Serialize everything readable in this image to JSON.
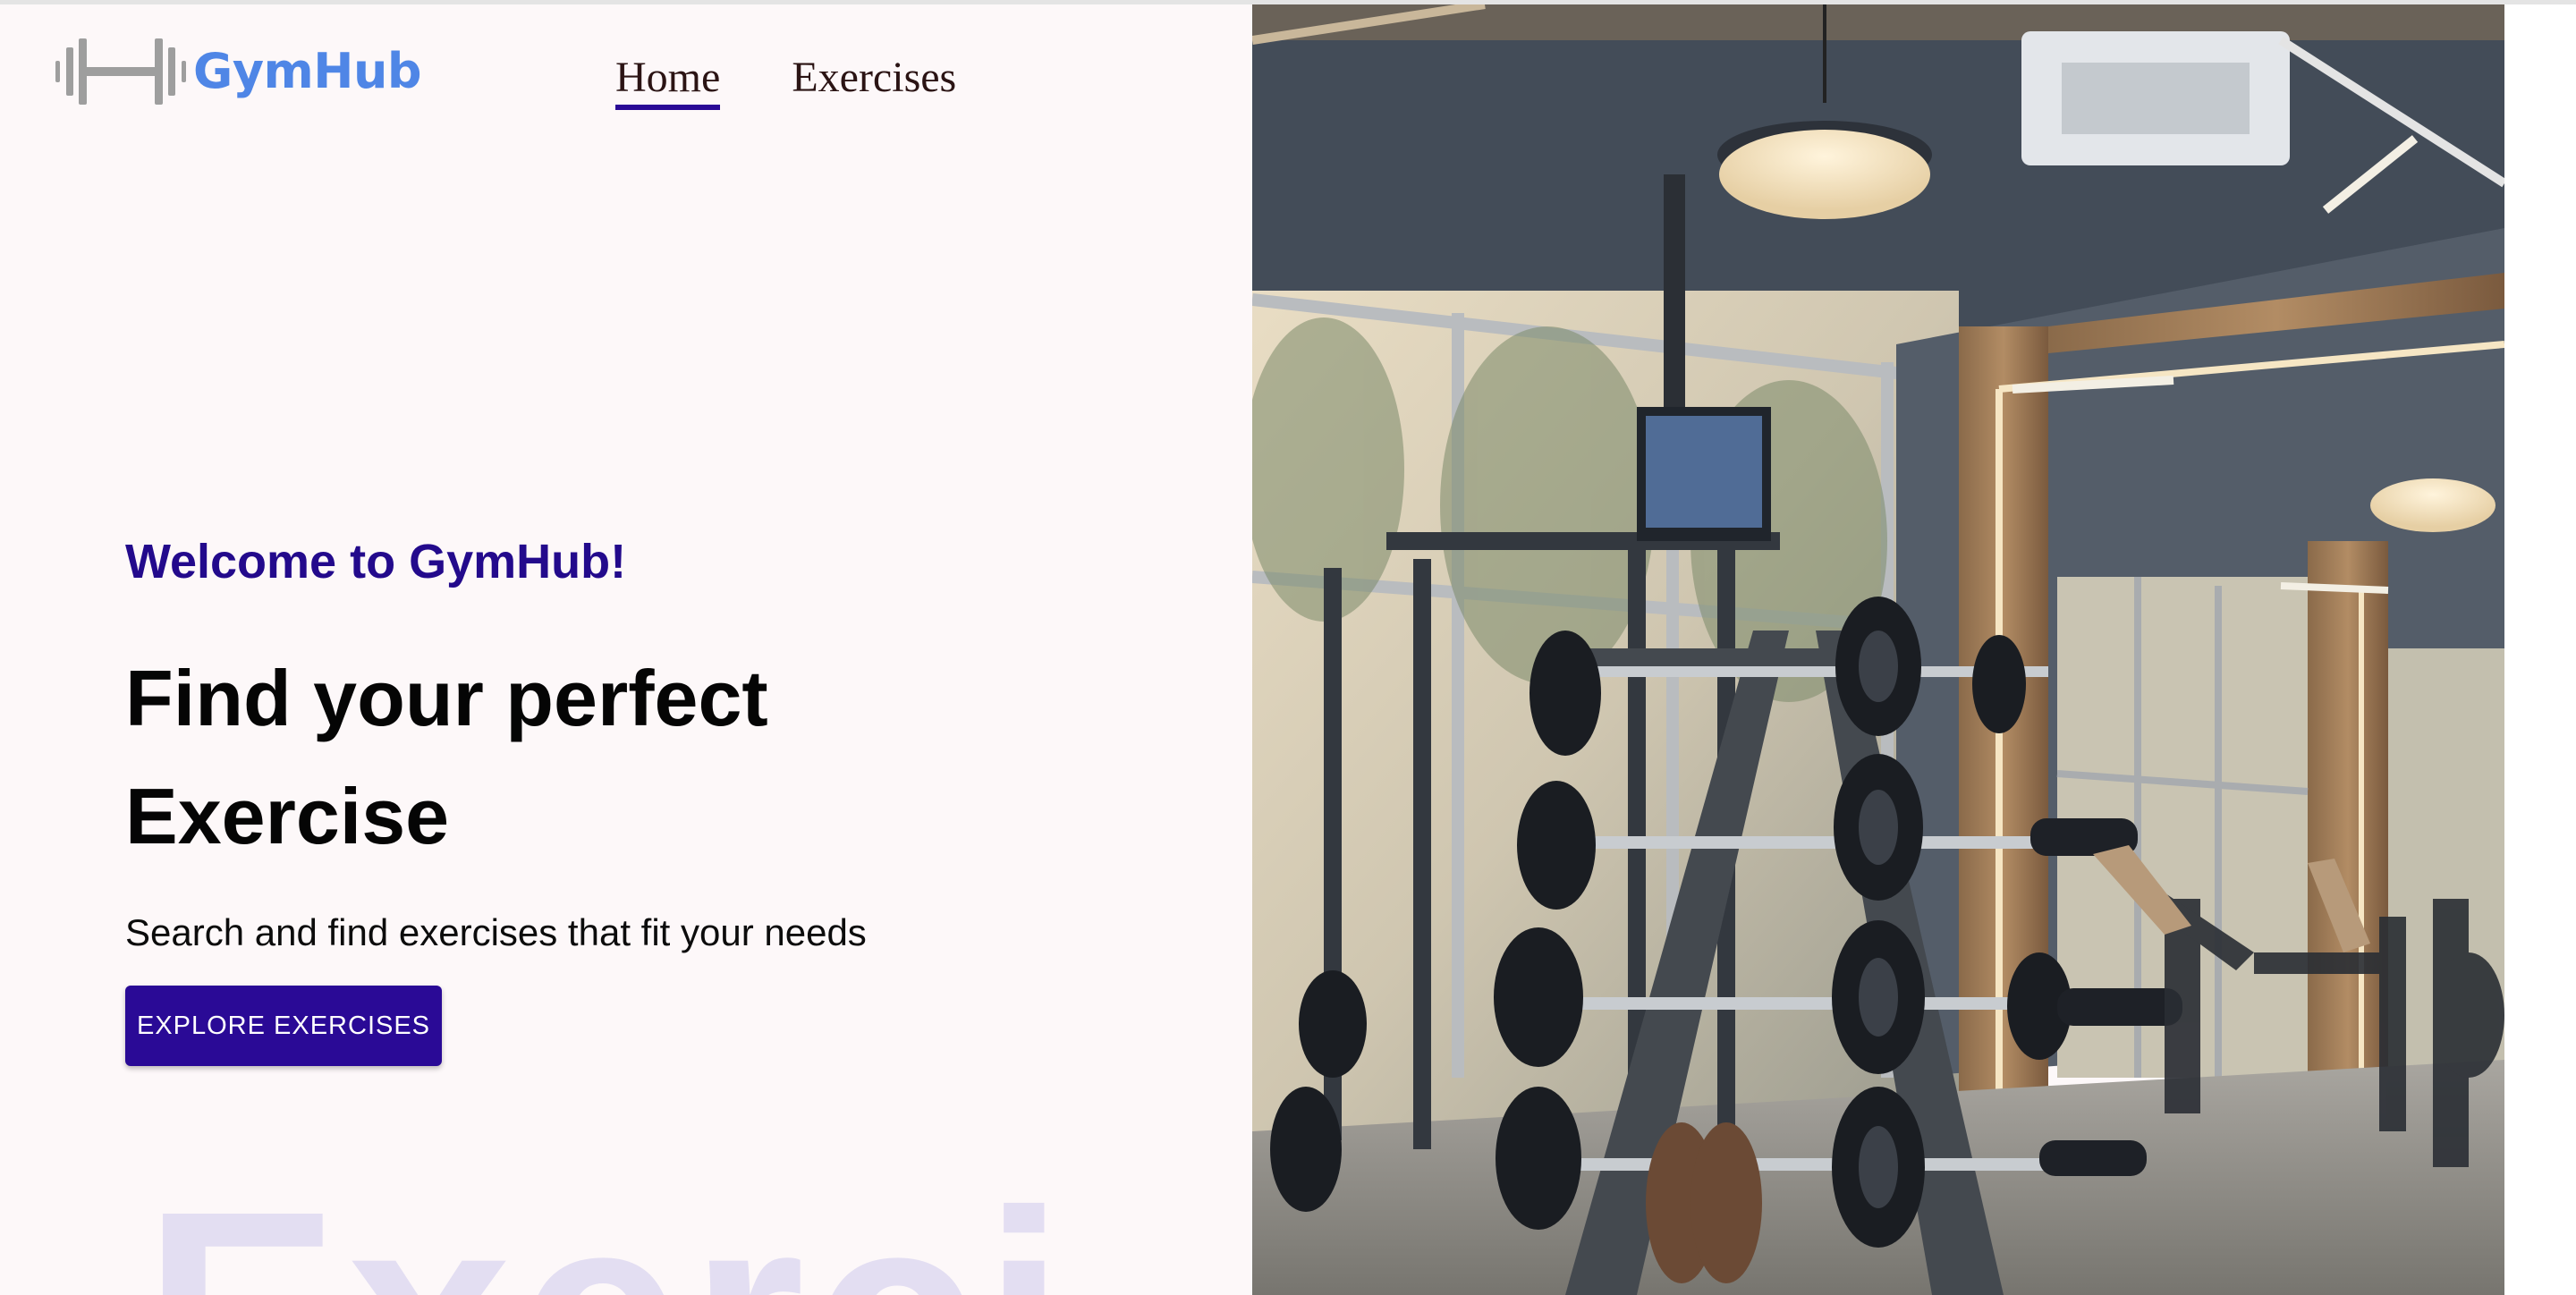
{
  "brand": {
    "name": "GymHub",
    "logo_icon": "barbell-icon",
    "text_color": "#4f86e6",
    "icon_color": "#9e9e9e"
  },
  "nav": {
    "items": [
      {
        "label": "Home",
        "active": true
      },
      {
        "label": "Exercises",
        "active": false
      }
    ],
    "active_underline_color": "#2a0a96"
  },
  "hero": {
    "welcome": "Welcome to GymHub!",
    "headline_line1": "Find your perfect",
    "headline_line2": "Exercise",
    "subtext": "Search and find exercises that fit your needs",
    "cta_label": "EXPLORE EXERCISES",
    "background_word": "Exerci",
    "accent_color": "#2a0a96",
    "image_icon": "gym-interior-photo"
  }
}
